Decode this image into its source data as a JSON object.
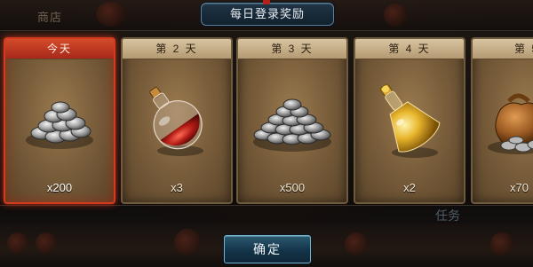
{
  "background": {
    "shop_label": "商店",
    "task_label": "任务"
  },
  "dialog": {
    "title": "每日登录奖励",
    "confirm_label": "确定"
  },
  "rewards": [
    {
      "day_label": "今天",
      "item_icon": "silver-coins-icon",
      "quantity": "x200",
      "active": true
    },
    {
      "day_label": "第 2 天",
      "item_icon": "red-potion-icon",
      "quantity": "x3",
      "active": false
    },
    {
      "day_label": "第 3 天",
      "item_icon": "silver-coins-pile-icon",
      "quantity": "x500",
      "active": false
    },
    {
      "day_label": "第 4 天",
      "item_icon": "gold-potion-icon",
      "quantity": "x2",
      "active": false
    },
    {
      "day_label": "第 5",
      "item_icon": "coin-sack-icon",
      "quantity": "x70",
      "active": false
    }
  ],
  "colors": {
    "active_border": "#d43a1e",
    "card_border": "#6e5a3e",
    "confirm_border": "#75b2cc"
  }
}
